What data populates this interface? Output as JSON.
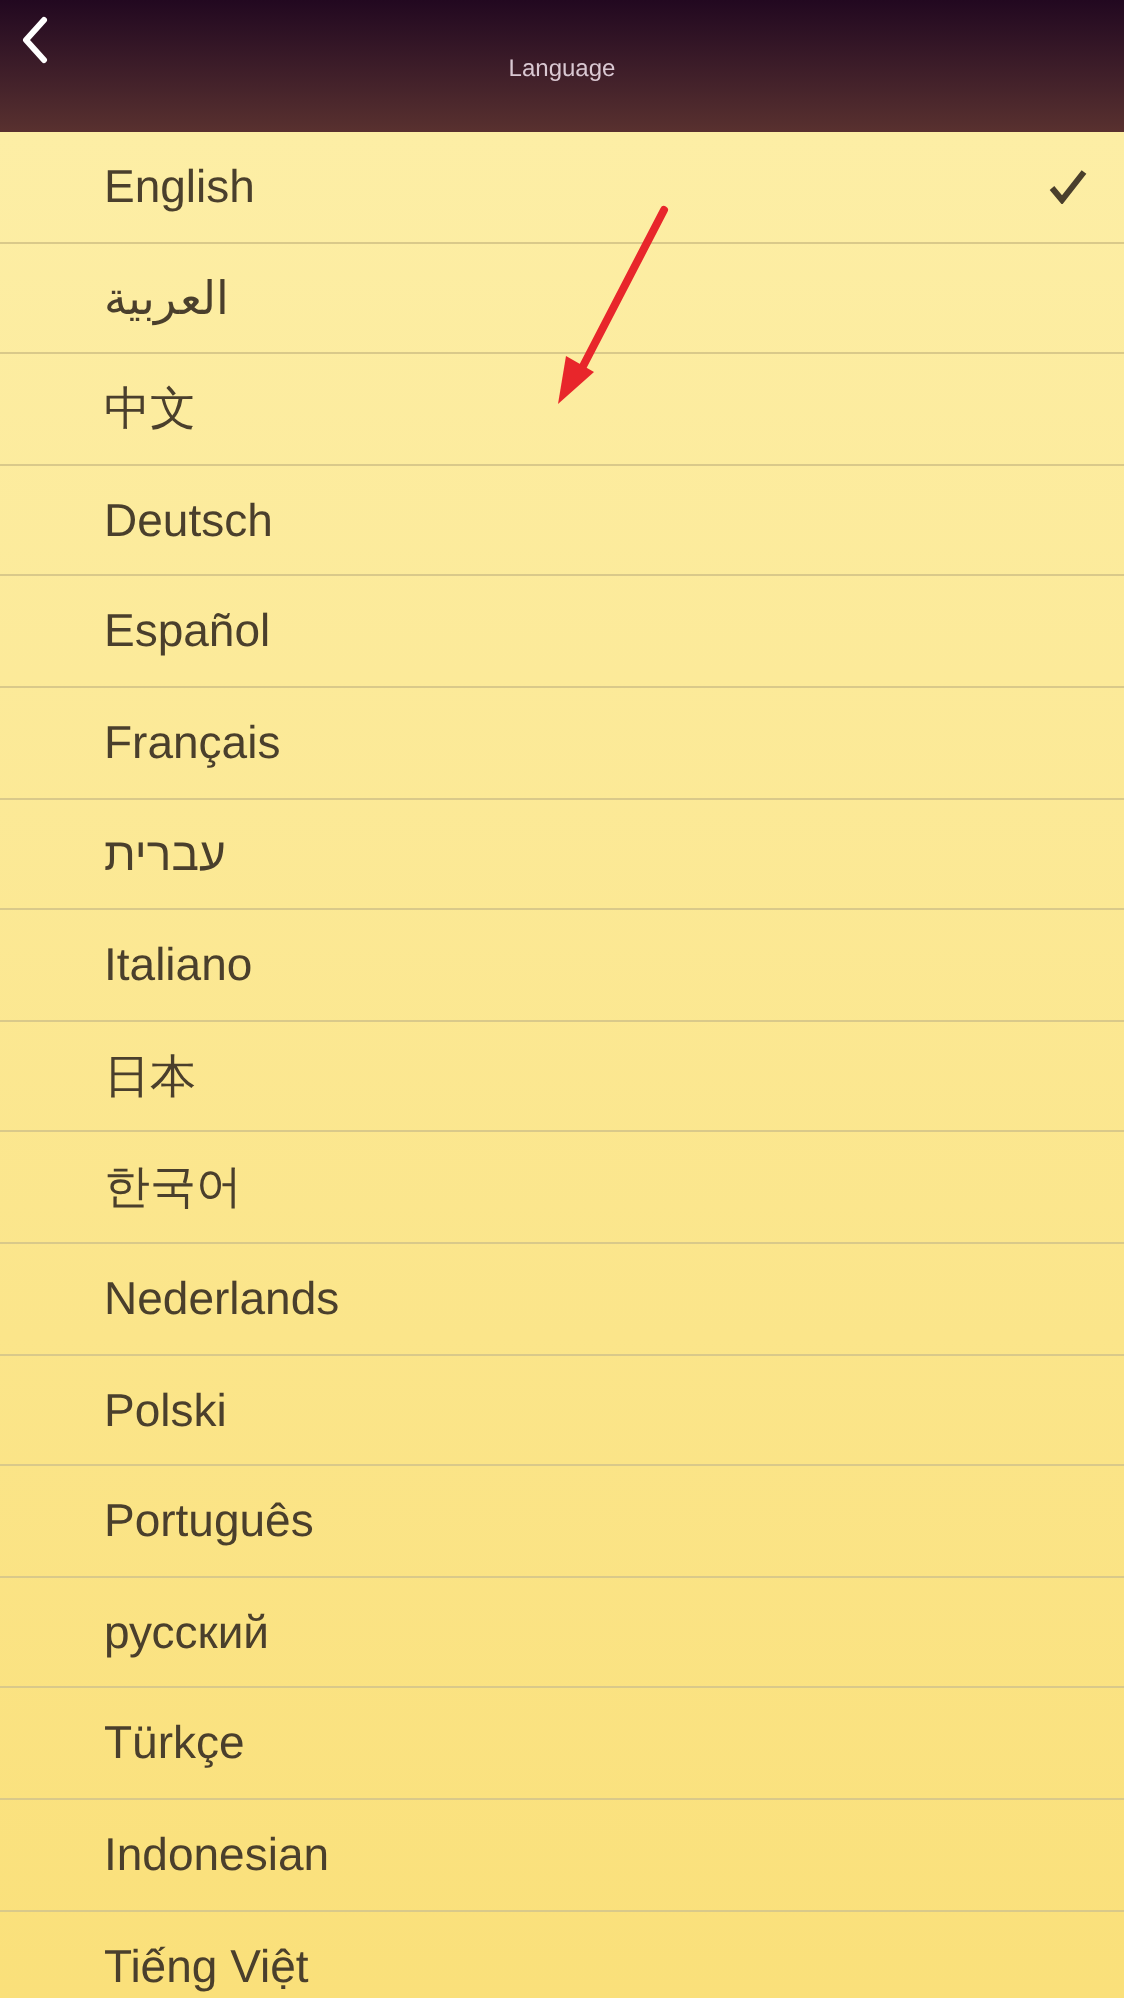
{
  "header": {
    "title": "Language"
  },
  "languages": [
    {
      "label": "English",
      "selected": true
    },
    {
      "label": "العربية",
      "selected": false
    },
    {
      "label": "中文",
      "selected": false
    },
    {
      "label": "Deutsch",
      "selected": false
    },
    {
      "label": "Español",
      "selected": false
    },
    {
      "label": "Français",
      "selected": false
    },
    {
      "label": "עברית",
      "selected": false
    },
    {
      "label": "Italiano",
      "selected": false
    },
    {
      "label": "日本",
      "selected": false
    },
    {
      "label": "한국어",
      "selected": false
    },
    {
      "label": "Nederlands",
      "selected": false
    },
    {
      "label": "Polski",
      "selected": false
    },
    {
      "label": "Português",
      "selected": false
    },
    {
      "label": "русский",
      "selected": false
    },
    {
      "label": "Türkçe",
      "selected": false
    },
    {
      "label": "Indonesian",
      "selected": false
    },
    {
      "label": "Tiếng Việt",
      "selected": false
    }
  ]
}
